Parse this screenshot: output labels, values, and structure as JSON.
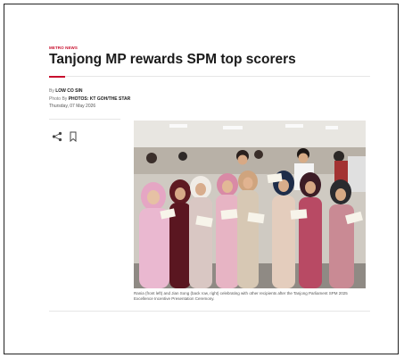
{
  "article": {
    "section": "METRO NEWS",
    "headline": "Tanjong MP rewards SPM top scorers",
    "byline_prefix": "By ",
    "author": "LOW CO SIN",
    "photo_prefix": "Photo By ",
    "photo_credit": "PHOTOS: KT GOH/THE STAR",
    "date": "Thursday, 07 May 2026",
    "caption": "Rania (front left) and Jian Song (back row, right) celebrating with other recipients after the Tanjong Parliament SPM 2025 Excellence Incentive Presentation Ceremony."
  },
  "colors": {
    "accent": "#c8102e",
    "text": "#1a1a1a",
    "muted": "#777777"
  },
  "icons": {
    "share": "share-icon",
    "bookmark": "bookmark-icon"
  }
}
